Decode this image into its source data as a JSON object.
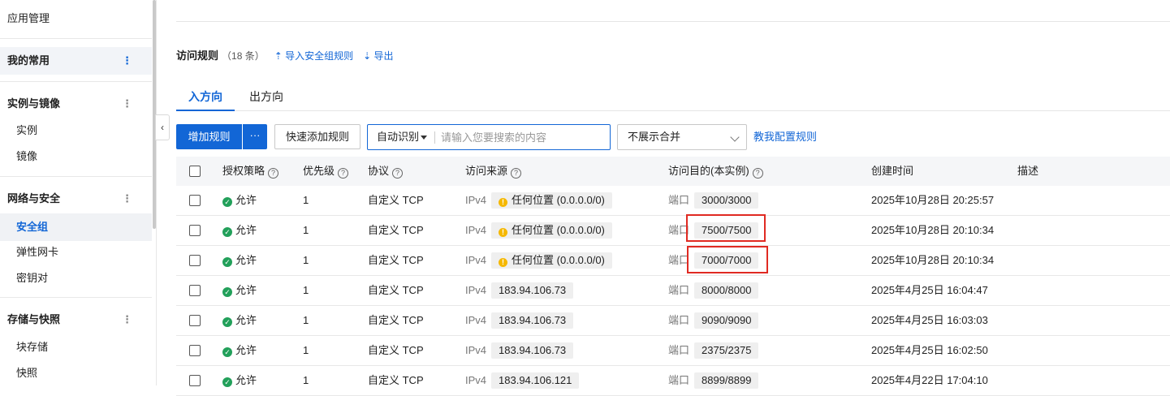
{
  "sidebar": {
    "items": [
      {
        "label": "应用管理"
      },
      {
        "label": "我的常用"
      },
      {
        "label": "实例与镜像"
      },
      {
        "label": "实例"
      },
      {
        "label": "镜像"
      },
      {
        "label": "网络与安全"
      },
      {
        "label": "安全组"
      },
      {
        "label": "弹性网卡"
      },
      {
        "label": "密钥对"
      },
      {
        "label": "存储与快照"
      },
      {
        "label": "块存储"
      },
      {
        "label": "快照"
      }
    ],
    "more_glyph": "⋮",
    "collapse_glyph": "‹"
  },
  "rules": {
    "title": "访问规则",
    "count": "（18 条）",
    "import_label": "⇡ 导入安全组规则",
    "export_label": "⇣ 导出"
  },
  "tabs": [
    {
      "label": "入方向"
    },
    {
      "label": "出方向"
    }
  ],
  "toolbar": {
    "add_rule": "增加规则",
    "more": "···",
    "quick_add": "快速添加规则",
    "search_mode": "自动识别",
    "search_placeholder": "请输入您要搜索的内容",
    "merge_select": "不展示合并",
    "teach_link": "教我配置规则"
  },
  "table": {
    "headers": {
      "policy": "授权策略",
      "priority": "优先级",
      "protocol": "协议",
      "source": "访问来源",
      "dest": "访问目的(本实例)",
      "created": "创建时间",
      "desc": "描述"
    },
    "help_glyph": "?",
    "rows": [
      {
        "policy": "允许",
        "priority": "1",
        "protocol": "自定义 TCP",
        "ip_ver": "IPv4",
        "source": "任何位置 (0.0.0.0/0)",
        "port_label": "端口",
        "port": "3000/3000",
        "created": "2025年10月28日 20:25:57"
      },
      {
        "policy": "允许",
        "priority": "1",
        "protocol": "自定义 TCP",
        "ip_ver": "IPv4",
        "source": "任何位置 (0.0.0.0/0)",
        "port_label": "端口",
        "port": "7500/7500",
        "created": "2025年10月28日 20:10:34"
      },
      {
        "policy": "允许",
        "priority": "1",
        "protocol": "自定义 TCP",
        "ip_ver": "IPv4",
        "source": "任何位置 (0.0.0.0/0)",
        "port_label": "端口",
        "port": "7000/7000",
        "created": "2025年10月28日 20:10:34"
      },
      {
        "policy": "允许",
        "priority": "1",
        "protocol": "自定义 TCP",
        "ip_ver": "IPv4",
        "source": "183.94.106.73",
        "port_label": "端口",
        "port": "8000/8000",
        "created": "2025年4月25日 16:04:47"
      },
      {
        "policy": "允许",
        "priority": "1",
        "protocol": "自定义 TCP",
        "ip_ver": "IPv4",
        "source": "183.94.106.73",
        "port_label": "端口",
        "port": "9090/9090",
        "created": "2025年4月25日 16:03:03"
      },
      {
        "policy": "允许",
        "priority": "1",
        "protocol": "自定义 TCP",
        "ip_ver": "IPv4",
        "source": "183.94.106.73",
        "port_label": "端口",
        "port": "2375/2375",
        "created": "2025年4月25日 16:02:50"
      },
      {
        "policy": "允许",
        "priority": "1",
        "protocol": "自定义 TCP",
        "ip_ver": "IPv4",
        "source": "183.94.106.121",
        "port_label": "端口",
        "port": "8899/8899",
        "created": "2025年4月22日 17:04:10"
      }
    ]
  },
  "colors": {
    "accent": "#1266d6",
    "success": "#22a05a",
    "warning": "#f5b800",
    "highlight_box": "#e02a22"
  }
}
